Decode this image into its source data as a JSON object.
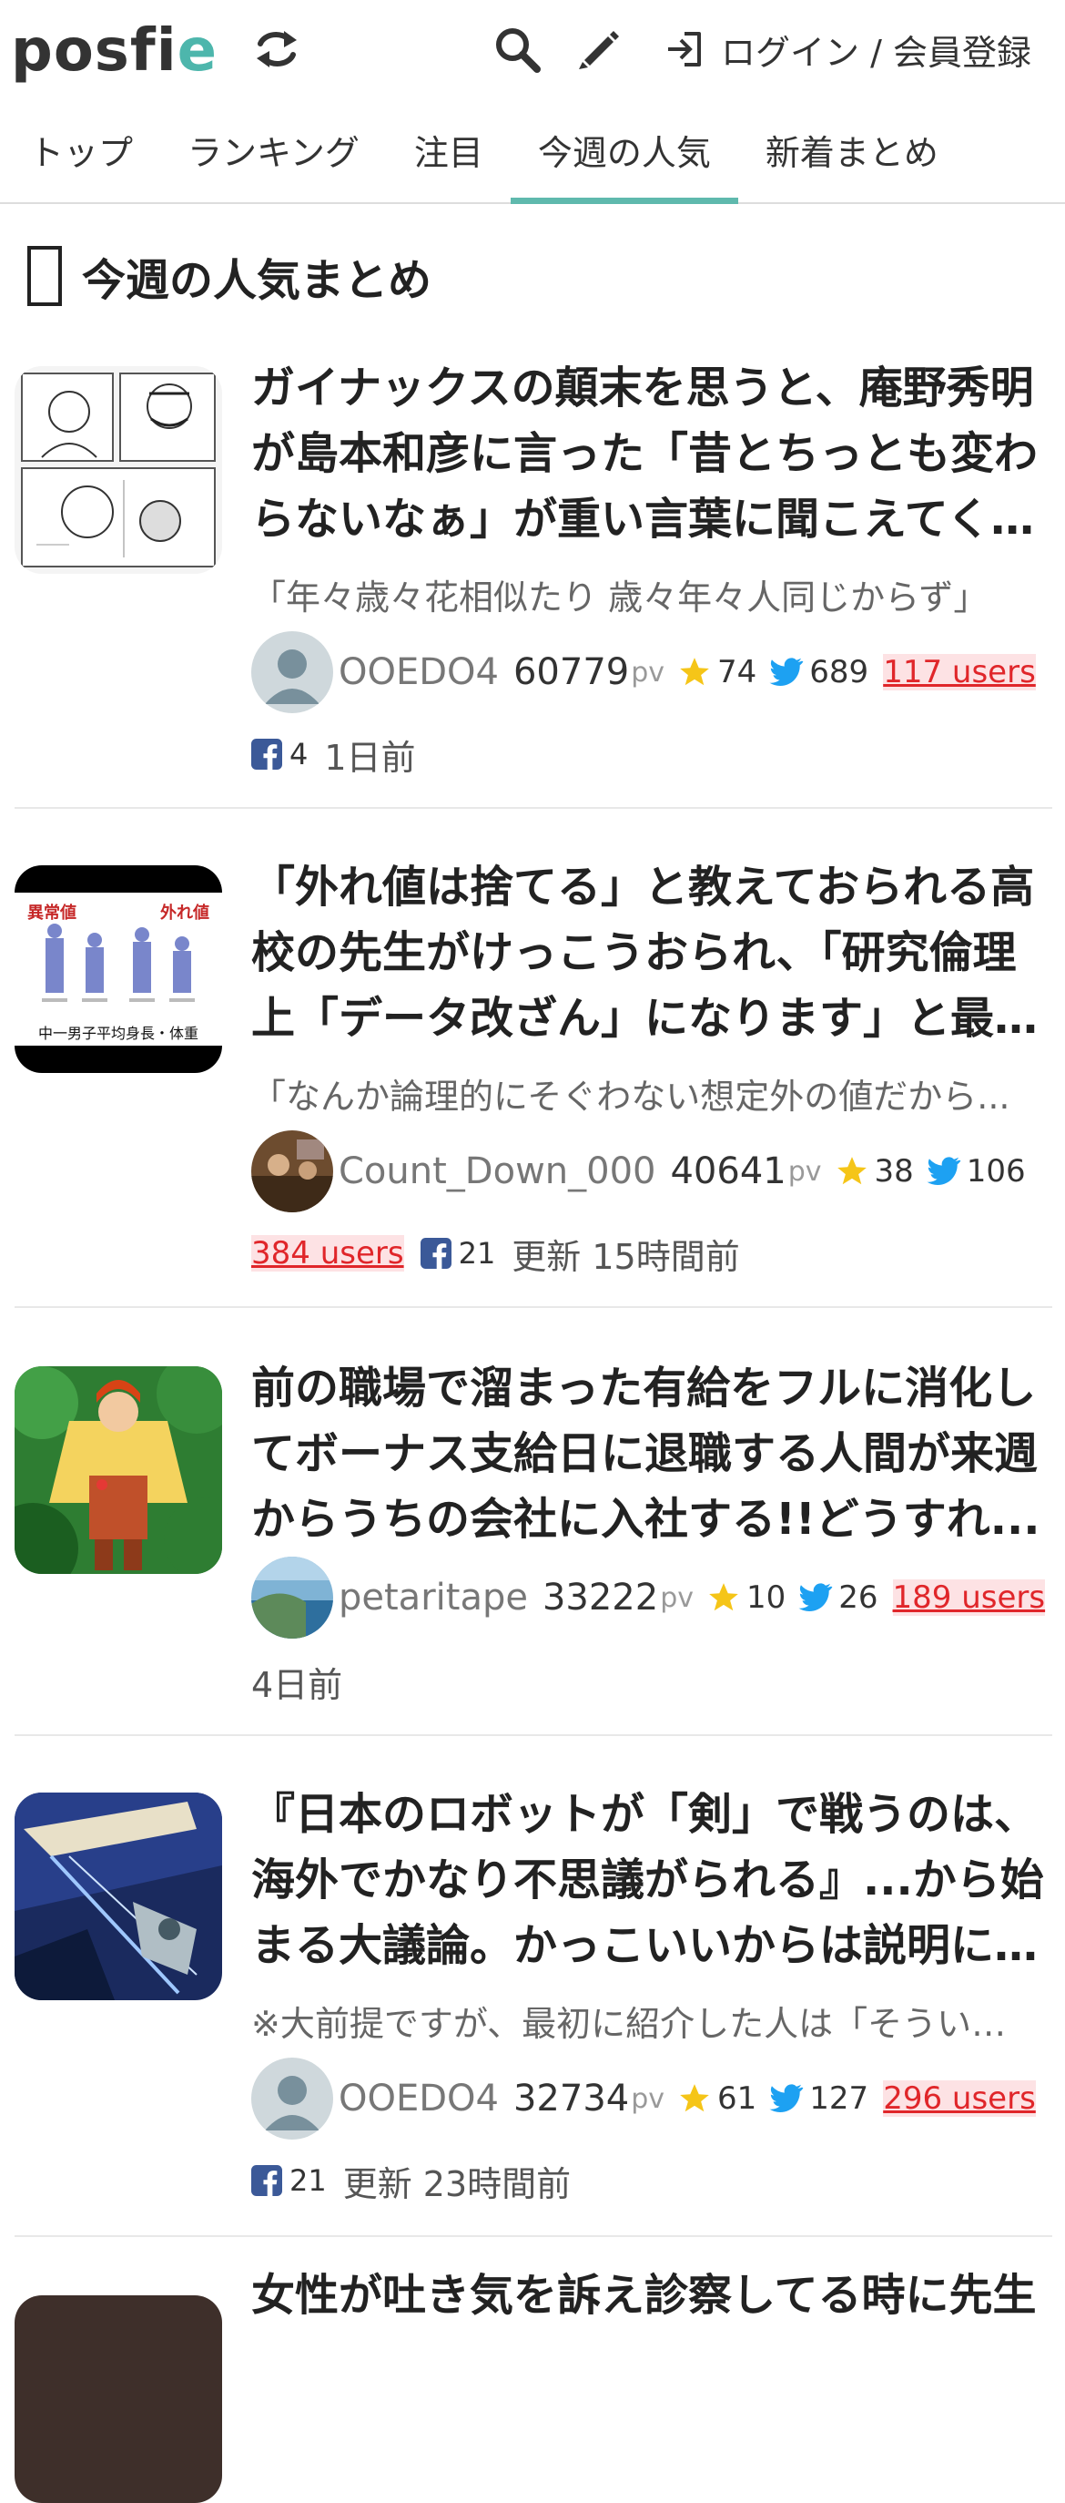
{
  "header": {
    "logo_main": "posfi",
    "logo_e": "e",
    "login_label": "ログイン / 会員登録",
    "icons": [
      "refresh-icon",
      "search-icon",
      "pencil-icon",
      "login-icon"
    ]
  },
  "tabs": [
    {
      "label": "トップ",
      "active": false
    },
    {
      "label": "ランキング",
      "active": false
    },
    {
      "label": "注目",
      "active": false
    },
    {
      "label": "今週の人気",
      "active": true
    },
    {
      "label": "新着まとめ",
      "active": false
    }
  ],
  "section": {
    "title": "今週の人気まとめ"
  },
  "colors": {
    "accent": "#5fb9ad",
    "users": "#e0262a",
    "users_bg": "#fde2e4",
    "star": "#f5c518",
    "twitter": "#1da1f2",
    "facebook": "#3b5998"
  },
  "articles": [
    {
      "title": "ガイナックスの顛末を思うと、庵野秀明が島本和彦に言った「昔とちっとも変わらないなぁ」が重い言葉に聞こえてくる、...",
      "description": "「年々歳々花相似たり 歳々年々人同じからず」",
      "author": "OOEDO4",
      "pv": "60779",
      "pv_unit": "pv",
      "stars": "74",
      "tweets": "689",
      "users": "117 users",
      "facebook": "4",
      "time": "1日前"
    },
    {
      "title": "「外れ値は捨てる」と教えておられる高校の先生がけっこうおられ、「研究倫理上「データ改ざん」になります」と最近は...",
      "description": "「なんか論理的にそぐわない想定外の値だから...",
      "author": "Count_Down_000",
      "pv": "40641",
      "pv_unit": "pv",
      "stars": "38",
      "tweets": "106",
      "users": "384 users",
      "facebook": "21",
      "time": "更新 15時間前",
      "thumb_labels": {
        "left": "異常値",
        "right": "外れ値",
        "bottom": "中一男子平均身長・体重"
      }
    },
    {
      "title": "前の職場で溜まった有給をフルに消化してボーナス支給日に退職する人間が来週からうちの会社に入社する!!どうすれ...",
      "description": "",
      "author": "petaritape",
      "pv": "33222",
      "pv_unit": "pv",
      "stars": "10",
      "tweets": "26",
      "users": "189 users",
      "time": "4日前"
    },
    {
      "title": "『日本のロボットが「剣」で戦うのは、海外でかなり不思議がられる』...から始まる大議論。かっこいいからは説明になる...",
      "description": "※大前提ですが、最初に紹介した人は「そういう...",
      "author": "OOEDO4",
      "pv": "32734",
      "pv_unit": "pv",
      "stars": "61",
      "tweets": "127",
      "users": "296 users",
      "facebook": "21",
      "time": "更新 23時間前"
    },
    {
      "title": "女性が吐き気を訴え診察してる時に先生"
    }
  ]
}
